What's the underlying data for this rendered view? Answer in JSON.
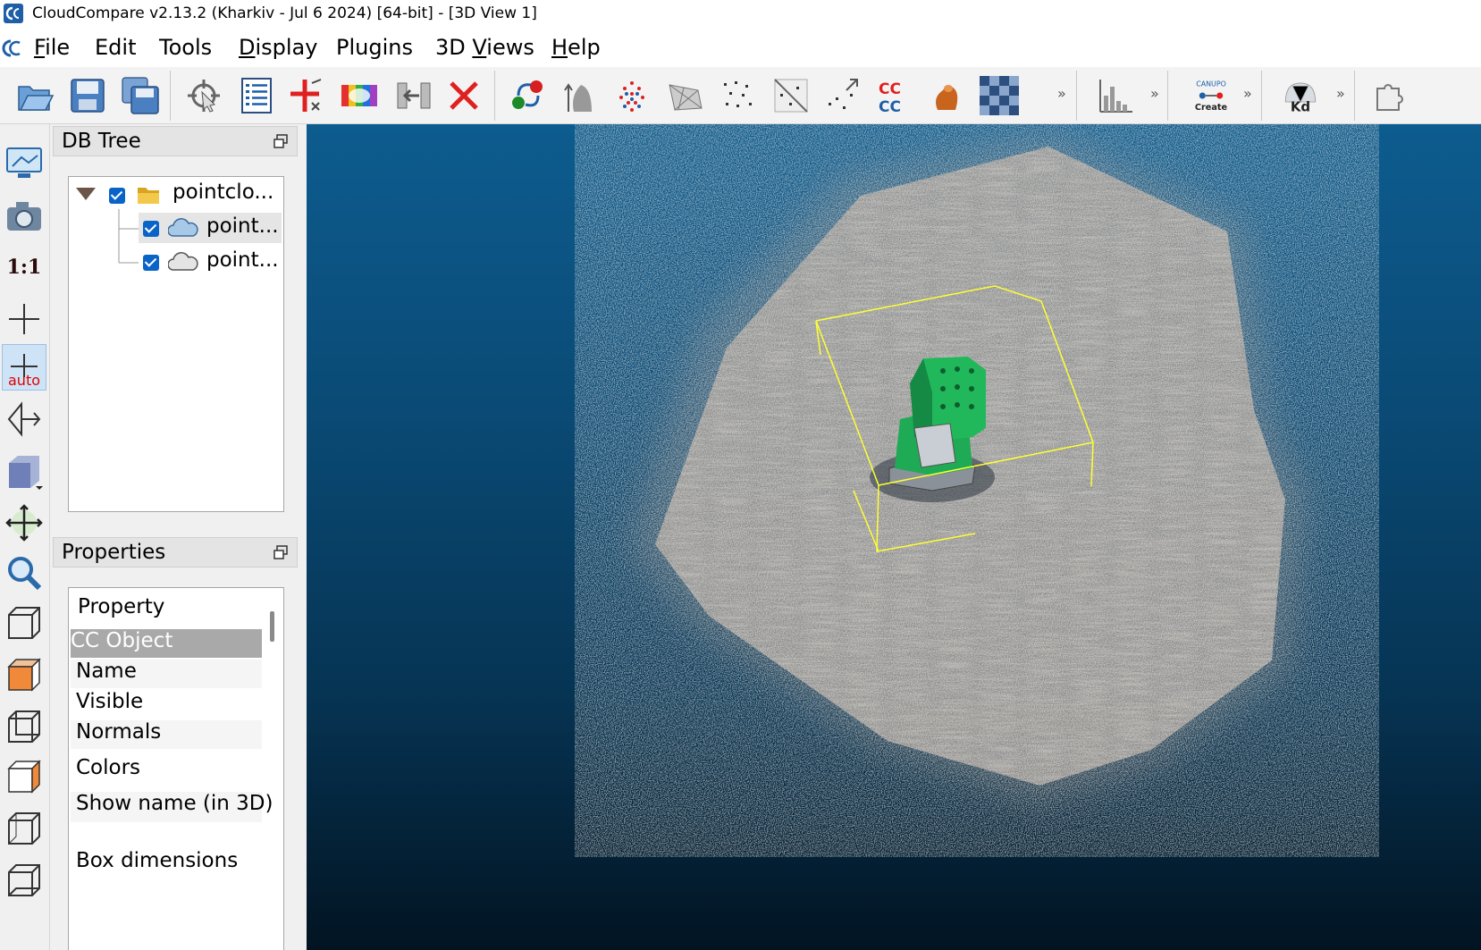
{
  "window": {
    "title": "CloudCompare v2.13.2 (Kharkiv - Jul  6 2024) [64-bit] - [3D View 1]"
  },
  "menubar": {
    "items": [
      "File",
      "Edit",
      "Tools",
      "Display",
      "Plugins",
      "3D Views",
      "Help"
    ]
  },
  "toolbar": {
    "chevron": "»",
    "buttons": [
      "open-folder-icon",
      "save-icon",
      "save-all-icon",
      "pick-icon",
      "list-icon",
      "add-point-icon",
      "color-icon",
      "merge-icon",
      "delete-icon",
      "register-icon",
      "normals-icon",
      "sample-icon",
      "mesh-icon",
      "subsample-icon",
      "segment-icon",
      "noise-icon",
      "cc-compare-icon",
      "statistics-icon",
      "checker-icon",
      "histogram-icon",
      "canupo-icon",
      "kd-tree-icon",
      "plugin-icon"
    ],
    "canupo_label": "CANUPO",
    "canupo_sub": "Create",
    "kd_label": "Kd"
  },
  "left_tools": {
    "one_to_one": "1:1",
    "auto_label": "auto"
  },
  "db_tree": {
    "title": "DB Tree",
    "items": [
      {
        "label": "pointclo...",
        "checked": true,
        "expanded": true,
        "icon": "folder-icon"
      },
      {
        "label": "point...",
        "checked": true,
        "selected": true,
        "icon": "cloud-icon"
      },
      {
        "label": "point...",
        "checked": true,
        "icon": "cloud-icon"
      }
    ]
  },
  "properties": {
    "title": "Properties",
    "header": "Property",
    "group": "CC Object",
    "rows": [
      "Name",
      "Visible",
      "Normals",
      "Colors",
      "Show name (in 3D)",
      "Box dimensions"
    ]
  },
  "colors": {
    "accent": "#0a64c8",
    "bbox": "#ffff33",
    "object_green": "#1faa55"
  }
}
